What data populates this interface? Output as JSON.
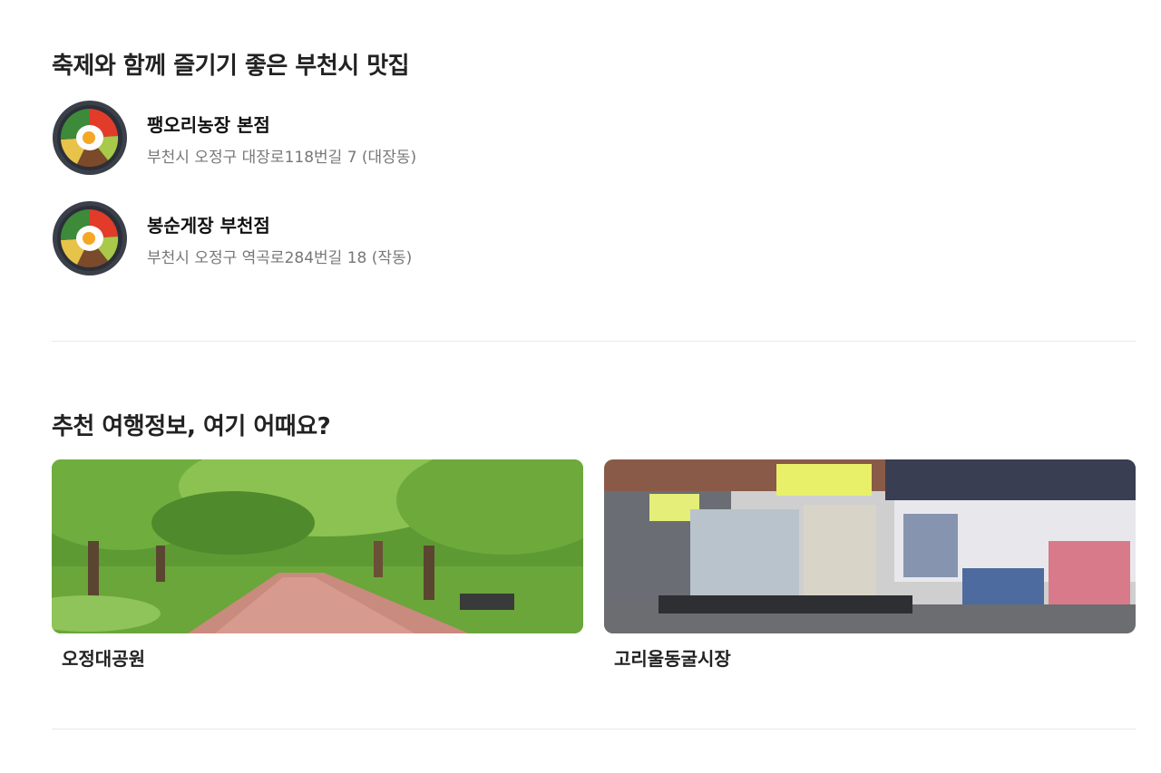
{
  "food_section": {
    "title": "축제와 함께 즐기기 좋은 부천시 맛집",
    "items": [
      {
        "name": "팽오리농장 본점",
        "address": "부천시 오정구 대장로118번길 7 (대장동)",
        "icon": "bibimbap-icon"
      },
      {
        "name": "봉순게장 부천점",
        "address": "부천시 오정구 역곡로284번길 18 (작동)",
        "icon": "bibimbap-icon"
      }
    ]
  },
  "recommend_section": {
    "title": "추천 여행정보, 여기 어때요?",
    "cards": [
      {
        "title": "오정대공원",
        "image": "park-tree-path-photo"
      },
      {
        "title": "고리울동굴시장",
        "image": "market-clothing-stall-photo"
      }
    ]
  }
}
